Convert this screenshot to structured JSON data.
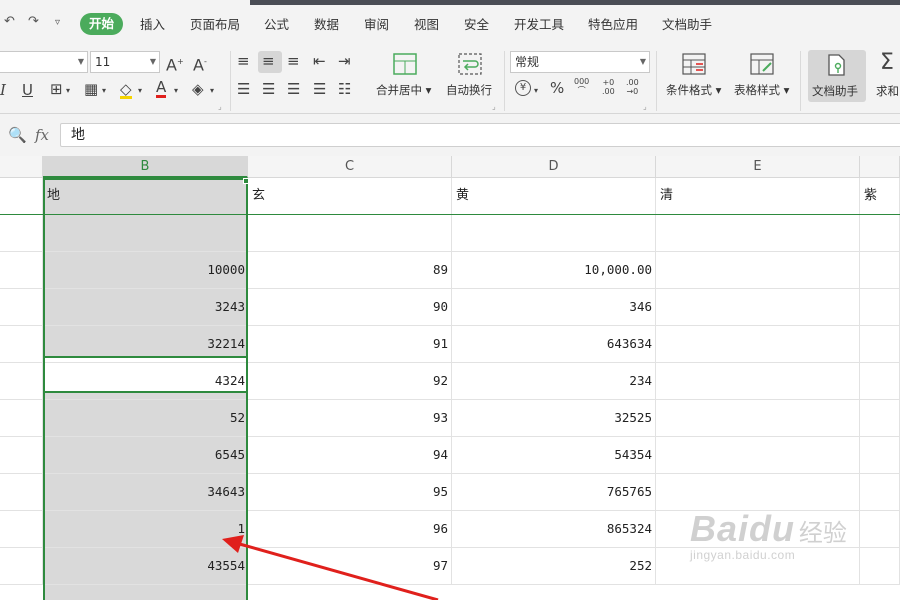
{
  "menu": {
    "tabs": [
      "开始",
      "插入",
      "页面布局",
      "公式",
      "数据",
      "审阅",
      "视图",
      "安全",
      "开发工具",
      "特色应用",
      "文档助手"
    ],
    "active_tab": "开始"
  },
  "ribbon": {
    "font_name": "",
    "font_size": "11",
    "number_format": "常规",
    "merge_center_label": "合并居中",
    "wrap_label": "自动换行",
    "cond_format_label": "条件格式",
    "table_style_label": "表格样式",
    "doc_assistant_label": "文档助手",
    "sum_label": "求和",
    "currency_icon": "¥",
    "percent_icon": "%",
    "thousands_icon": "000",
    "inc_decimal_icon": "+0\n.00",
    "dec_decimal_icon": ".00\n→0"
  },
  "formula_bar": {
    "fx_label": "fx",
    "value": "地"
  },
  "grid": {
    "columns": [
      "B",
      "C",
      "D",
      "E"
    ],
    "selected_column": "B",
    "header_row": [
      "地",
      "玄",
      "黄",
      "清",
      "紫"
    ],
    "rows": [
      {
        "b": "",
        "c": "",
        "d": ""
      },
      {
        "b": "10000",
        "c": "89",
        "d": "10,000.00"
      },
      {
        "b": "3243",
        "c": "90",
        "d": "346"
      },
      {
        "b": "32214",
        "c": "91",
        "d": "643634"
      },
      {
        "b": "4324",
        "c": "92",
        "d": "234"
      },
      {
        "b": "52",
        "c": "93",
        "d": "32525"
      },
      {
        "b": "6545",
        "c": "94",
        "d": "54354"
      },
      {
        "b": "34643",
        "c": "95",
        "d": "765765"
      },
      {
        "b": "1",
        "c": "96",
        "d": "865324"
      },
      {
        "b": "43554",
        "c": "97",
        "d": "252"
      }
    ]
  },
  "colors": {
    "accent_green": "#4bab5c",
    "selection_green": "#2e8a3e",
    "annotation_red": "#e0201c"
  },
  "watermark": {
    "brand": "Baidu",
    "cn": "经验",
    "url": "jingyan.baidu.com"
  }
}
